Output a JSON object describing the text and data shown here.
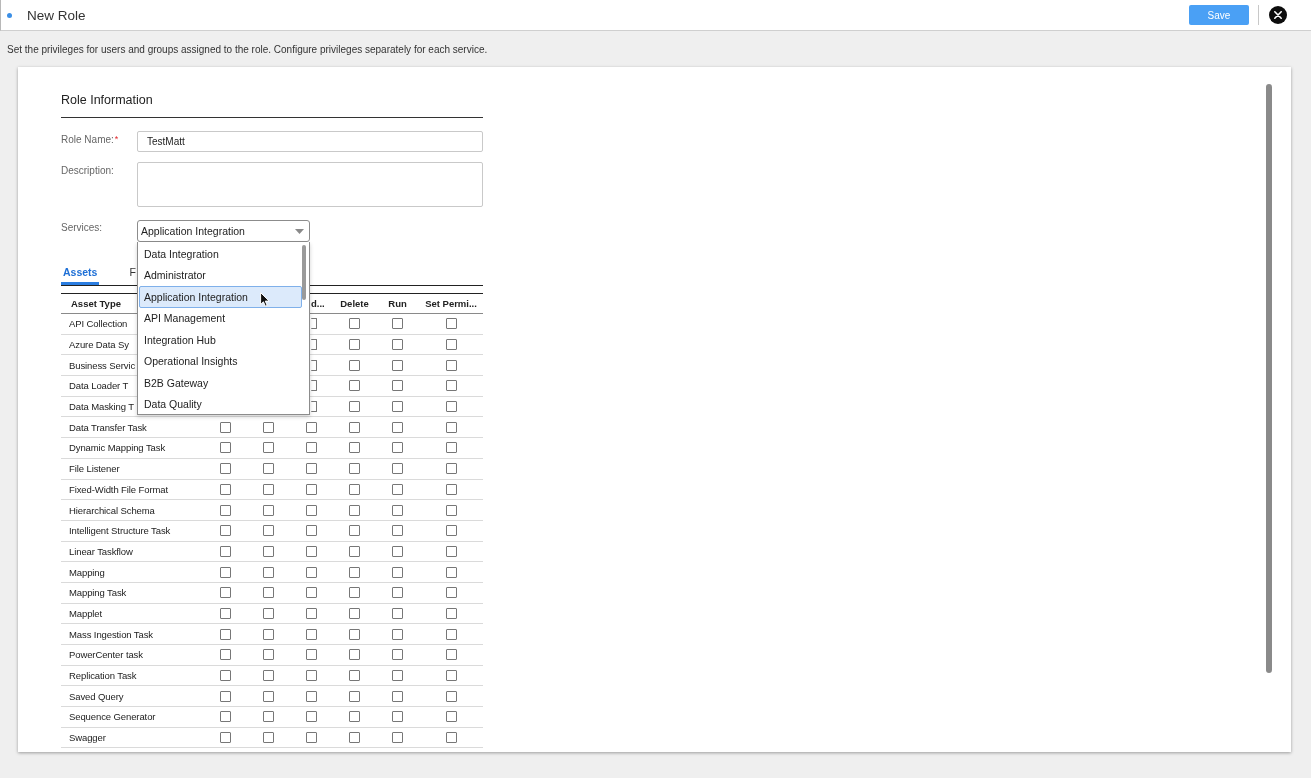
{
  "top_bar": {
    "title": "New Role",
    "save_button": "Save"
  },
  "instructions": "Set the privileges for users and groups assigned to the role. Configure privileges separately for each service.",
  "role_information": {
    "heading": "Role Information",
    "fields": [
      {
        "kind": "text",
        "label": "Role Name:",
        "required_mark": "*",
        "value": "TestMatt"
      },
      {
        "kind": "textarea",
        "label": "Description:"
      },
      {
        "kind": "select",
        "label": "Services:",
        "value": "Application Integration",
        "expanded": true,
        "options": [
          {
            "label": "Data Integration",
            "selected": false
          },
          {
            "label": "Administrator",
            "selected": false
          },
          {
            "label": "Application Integration",
            "selected": true
          },
          {
            "label": "API Management",
            "selected": false
          },
          {
            "label": "Integration Hub",
            "selected": false
          },
          {
            "label": "Operational Insights",
            "selected": false
          },
          {
            "label": "B2B Gateway",
            "selected": false
          },
          {
            "label": "Data Quality",
            "selected": false
          }
        ]
      }
    ]
  },
  "tabs": [
    {
      "label": "Assets",
      "selected": true
    },
    {
      "label": "F",
      "selected": false
    }
  ],
  "table": {
    "columns": [
      {
        "label": "Asset Type"
      },
      {
        "label": "d..."
      },
      {
        "label": "Delete"
      },
      {
        "label": "Run"
      },
      {
        "label": "Set Permi..."
      }
    ],
    "rows": [
      {
        "asset_type": "API Collection",
        "permissions": [
          {
            "checked": false
          },
          {
            "checked": false
          },
          {
            "checked": false
          },
          {
            "checked": false
          }
        ]
      },
      {
        "asset_type": "Azure Data Sy",
        "permissions": [
          {
            "checked": false
          },
          {
            "checked": false
          },
          {
            "checked": false
          },
          {
            "checked": false
          }
        ]
      },
      {
        "asset_type": "Business Servic",
        "permissions": [
          {
            "checked": false
          },
          {
            "checked": false
          },
          {
            "checked": false
          },
          {
            "checked": false
          }
        ]
      },
      {
        "asset_type": "Data Loader T",
        "permissions": [
          {
            "checked": false
          },
          {
            "checked": false
          },
          {
            "checked": false
          },
          {
            "checked": false
          }
        ]
      },
      {
        "asset_type": "Data Masking T",
        "permissions": [
          {
            "checked": false
          },
          {
            "checked": false
          },
          {
            "checked": false
          },
          {
            "checked": false
          }
        ]
      },
      {
        "asset_type": "Data Transfer Task",
        "permissions": [
          {
            "checked": false
          },
          {
            "checked": false
          },
          {
            "checked": false
          },
          {
            "checked": false
          },
          {
            "checked": false
          },
          {
            "checked": false
          }
        ]
      },
      {
        "asset_type": "Dynamic Mapping Task",
        "permissions": [
          {
            "checked": false
          },
          {
            "checked": false
          },
          {
            "checked": false
          },
          {
            "checked": false
          },
          {
            "checked": false
          },
          {
            "checked": false
          }
        ]
      },
      {
        "asset_type": "File Listener",
        "permissions": [
          {
            "checked": false
          },
          {
            "checked": false
          },
          {
            "checked": false
          },
          {
            "checked": false
          },
          {
            "checked": false
          },
          {
            "checked": false
          }
        ]
      },
      {
        "asset_type": "Fixed-Width File Format",
        "permissions": [
          {
            "checked": false
          },
          {
            "checked": false
          },
          {
            "checked": false
          },
          {
            "checked": false
          },
          {
            "checked": false
          },
          {
            "checked": false
          }
        ]
      },
      {
        "asset_type": "Hierarchical Schema",
        "permissions": [
          {
            "checked": false
          },
          {
            "checked": false
          },
          {
            "checked": false
          },
          {
            "checked": false
          },
          {
            "checked": false
          },
          {
            "checked": false
          }
        ]
      },
      {
        "asset_type": "Intelligent Structure Task",
        "permissions": [
          {
            "checked": false
          },
          {
            "checked": false
          },
          {
            "checked": false
          },
          {
            "checked": false
          },
          {
            "checked": false
          },
          {
            "checked": false
          }
        ]
      },
      {
        "asset_type": "Linear Taskflow",
        "permissions": [
          {
            "checked": false
          },
          {
            "checked": false
          },
          {
            "checked": false
          },
          {
            "checked": false
          },
          {
            "checked": false
          },
          {
            "checked": false
          }
        ]
      },
      {
        "asset_type": "Mapping",
        "permissions": [
          {
            "checked": false
          },
          {
            "checked": false
          },
          {
            "checked": false
          },
          {
            "checked": false
          },
          {
            "checked": false
          },
          {
            "checked": false
          }
        ]
      },
      {
        "asset_type": "Mapping Task",
        "permissions": [
          {
            "checked": false
          },
          {
            "checked": false
          },
          {
            "checked": false
          },
          {
            "checked": false
          },
          {
            "checked": false
          },
          {
            "checked": false
          }
        ]
      },
      {
        "asset_type": "Mapplet",
        "permissions": [
          {
            "checked": false
          },
          {
            "checked": false
          },
          {
            "checked": false
          },
          {
            "checked": false
          },
          {
            "checked": false
          },
          {
            "checked": false
          }
        ]
      },
      {
        "asset_type": "Mass Ingestion Task",
        "permissions": [
          {
            "checked": false
          },
          {
            "checked": false
          },
          {
            "checked": false
          },
          {
            "checked": false
          },
          {
            "checked": false
          },
          {
            "checked": false
          }
        ]
      },
      {
        "asset_type": "PowerCenter task",
        "permissions": [
          {
            "checked": false
          },
          {
            "checked": false
          },
          {
            "checked": false
          },
          {
            "checked": false
          },
          {
            "checked": false
          },
          {
            "checked": false
          }
        ]
      },
      {
        "asset_type": "Replication Task",
        "permissions": [
          {
            "checked": false
          },
          {
            "checked": false
          },
          {
            "checked": false
          },
          {
            "checked": false
          },
          {
            "checked": false
          },
          {
            "checked": false
          }
        ]
      },
      {
        "asset_type": "Saved Query",
        "permissions": [
          {
            "checked": false
          },
          {
            "checked": false
          },
          {
            "checked": false
          },
          {
            "checked": false
          },
          {
            "checked": false
          },
          {
            "checked": false
          }
        ]
      },
      {
        "asset_type": "Sequence Generator",
        "permissions": [
          {
            "checked": false
          },
          {
            "checked": false
          },
          {
            "checked": false
          },
          {
            "checked": false
          },
          {
            "checked": false
          },
          {
            "checked": false
          }
        ]
      },
      {
        "asset_type": "Swagger",
        "permissions": [
          {
            "checked": false
          },
          {
            "checked": false
          },
          {
            "checked": false
          },
          {
            "checked": false
          },
          {
            "checked": false
          },
          {
            "checked": false
          }
        ]
      }
    ]
  }
}
